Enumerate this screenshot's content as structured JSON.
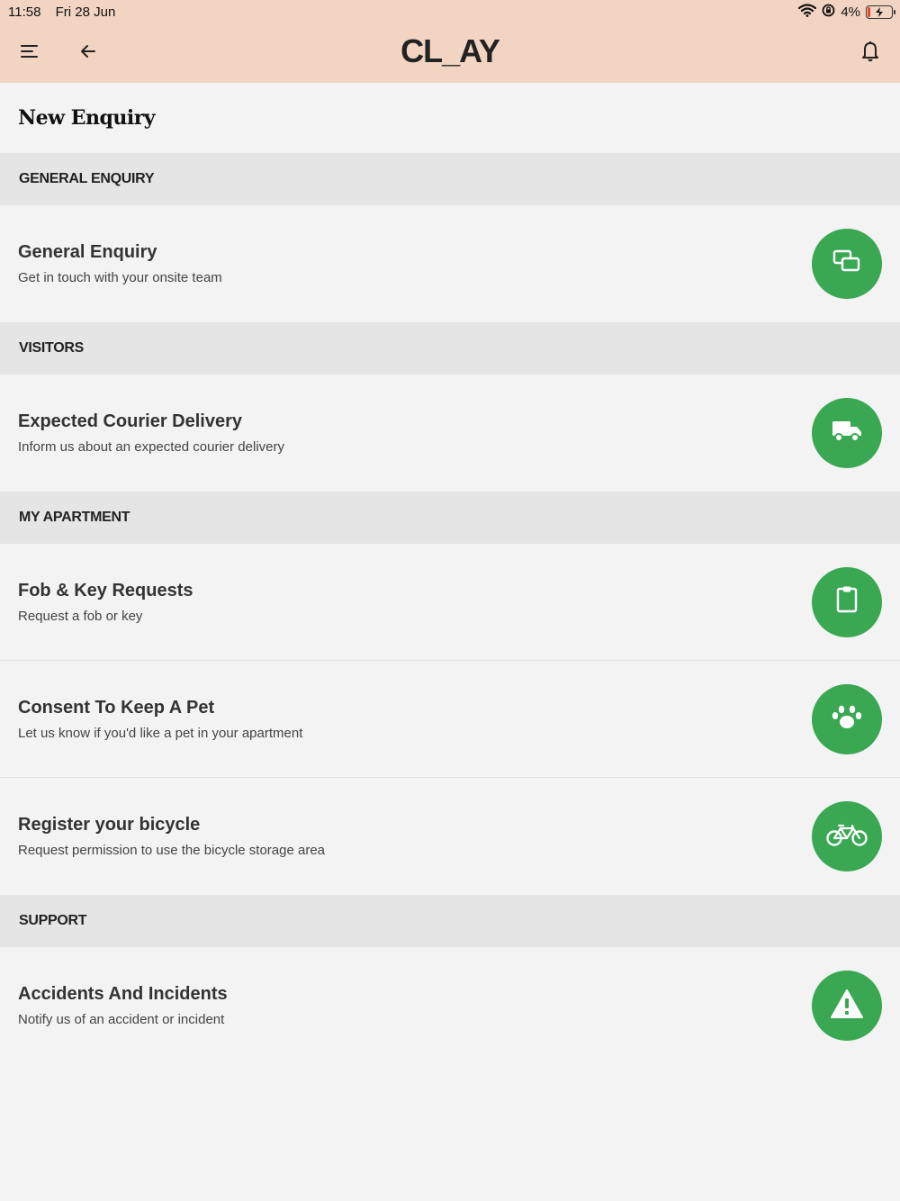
{
  "status_bar": {
    "time": "11:58",
    "date": "Fri 28 Jun",
    "battery": "4%"
  },
  "header": {
    "logo": "CL_AY",
    "menu_icon": "menu-icon",
    "back_icon": "arrow-left-icon",
    "notification_icon": "bell-icon"
  },
  "page": {
    "title": "New Enquiry"
  },
  "colors": {
    "header_bg": "#f1d4c1",
    "accent_green": "#3aa853",
    "section_bg": "#e5e5e5",
    "page_bg": "#f3f3f3"
  },
  "sections": [
    {
      "label": "GENERAL ENQUIRY",
      "items": [
        {
          "title": "General Enquiry",
          "subtitle": "Get in touch with your onsite team",
          "icon": "chat-icon"
        }
      ]
    },
    {
      "label": "VISITORS",
      "items": [
        {
          "title": "Expected Courier Delivery",
          "subtitle": "Inform us about an expected courier delivery",
          "icon": "truck-icon"
        }
      ]
    },
    {
      "label": "MY APARTMENT",
      "items": [
        {
          "title": "Fob & Key Requests",
          "subtitle": "Request a fob or key",
          "icon": "clipboard-icon"
        },
        {
          "title": "Consent To Keep A Pet",
          "subtitle": "Let us know if you'd like a pet in your apartment",
          "icon": "paw-icon"
        },
        {
          "title": "Register your bicycle",
          "subtitle": "Request permission to use the bicycle storage area",
          "icon": "bicycle-icon"
        }
      ]
    },
    {
      "label": "SUPPORT",
      "items": [
        {
          "title": "Accidents And Incidents",
          "subtitle": "Notify us of an accident or incident",
          "icon": "warning-icon"
        }
      ]
    }
  ]
}
